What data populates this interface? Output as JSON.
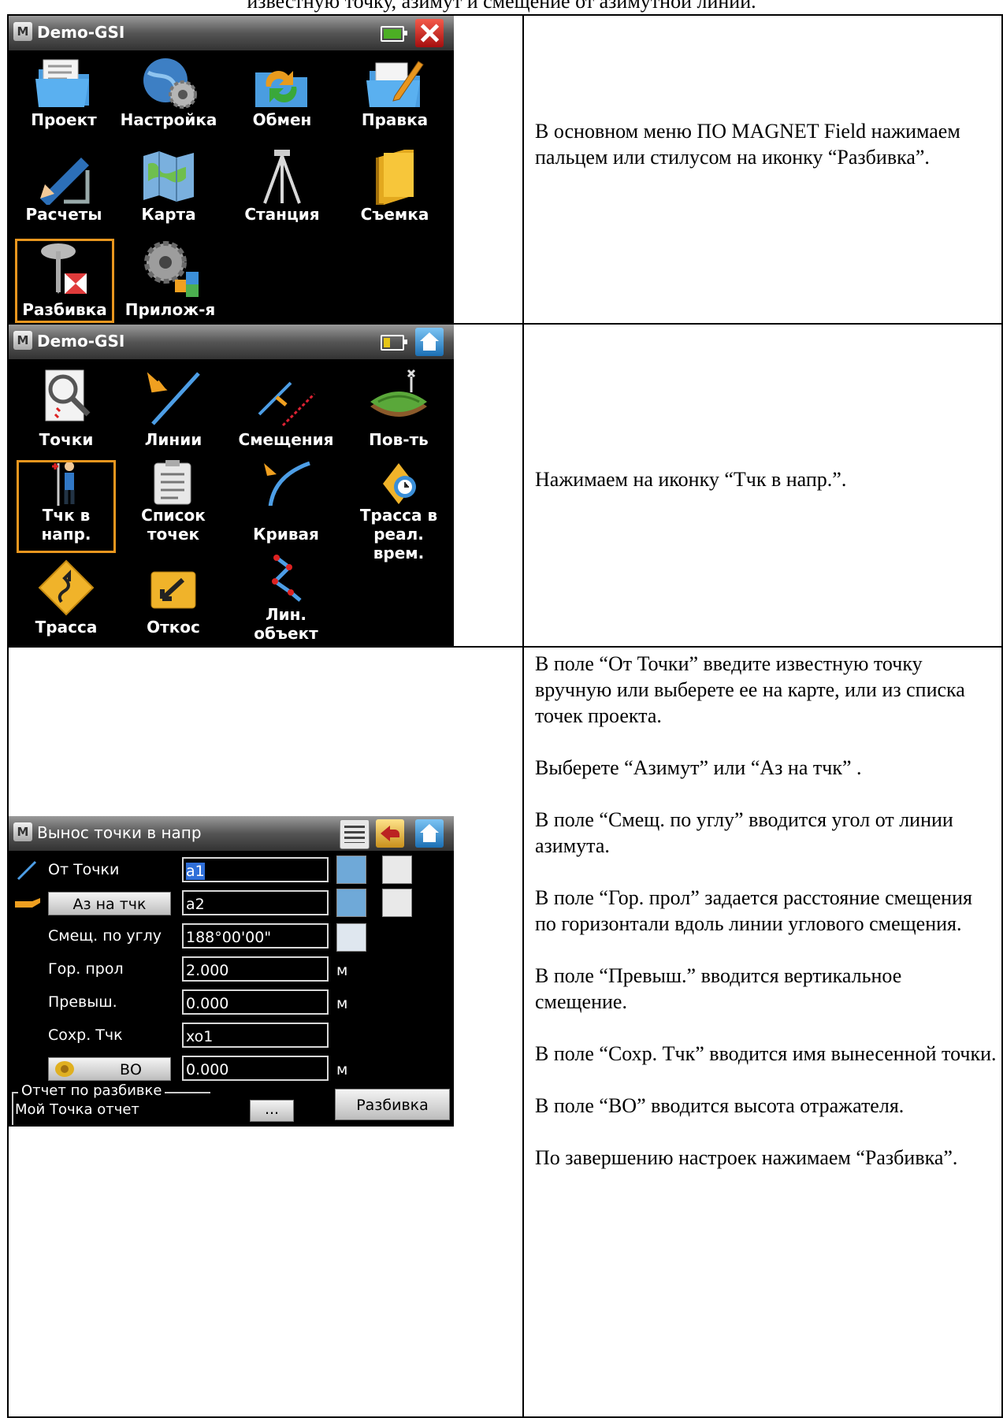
{
  "top_caption": "известную точку, азимут и смещение от азимутной линии.",
  "screen1": {
    "title": "Demo-GSI",
    "tiles": [
      {
        "label": "Проект",
        "icon": "folder-icon"
      },
      {
        "label": "Настройка",
        "icon": "globe-gear-icon"
      },
      {
        "label": "Обмен",
        "icon": "exchange-folder-icon"
      },
      {
        "label": "Правка",
        "icon": "edit-folder-icon"
      },
      {
        "label": "Расчеты",
        "icon": "ruler-pencil-icon"
      },
      {
        "label": "Карта",
        "icon": "map-icon"
      },
      {
        "label": "Станция",
        "icon": "tripod-icon"
      },
      {
        "label": "Съемка",
        "icon": "notebook-icon"
      },
      {
        "label": "Разбивка",
        "icon": "stakeout-pin-icon",
        "selected": true
      },
      {
        "label": "Прилож-я",
        "icon": "gear-blocks-icon"
      }
    ]
  },
  "screen2": {
    "title": "Demo-GSI",
    "tiles": [
      {
        "label": "Точки",
        "icon": "points-magnifier-icon"
      },
      {
        "label": "Линии",
        "icon": "line-icon"
      },
      {
        "label": "Смещения",
        "icon": "offset-line-icon"
      },
      {
        "label": "Пов-ть",
        "icon": "surface-icon"
      },
      {
        "label": "Тчк в напр.",
        "label_lines": [
          "Тчк в",
          "напр."
        ],
        "icon": "person-pole-icon",
        "selected": true
      },
      {
        "label": "Список точек",
        "label_lines": [
          "Список",
          "точек"
        ],
        "icon": "clipboard-list-icon"
      },
      {
        "label": "Кривая",
        "icon": "curve-icon"
      },
      {
        "label": "Трасса в реал. врем.",
        "label_lines": [
          "Трасса в",
          "реал.",
          "врем."
        ],
        "icon": "road-clock-icon"
      },
      {
        "label": "Трасса",
        "icon": "road-sign-icon"
      },
      {
        "label": "Откос",
        "icon": "slope-arrow-icon"
      },
      {
        "label": "Лин. объект",
        "label_lines": [
          "Лин.",
          "объект"
        ],
        "icon": "polyline-icon"
      }
    ]
  },
  "screen3": {
    "title": "Вынос точки в напр",
    "from_point_label": "От Точки",
    "from_point_value": "a1",
    "azimuth_button": "Аз на тчк",
    "azimuth_value": "a2",
    "angle_offset_label": "Смещ. по углу",
    "angle_offset_value": "188°00'00\"",
    "hd_label": "Гор. прол",
    "hd_value": "2.000",
    "hd_unit": "м",
    "vd_label": "Превыш.",
    "vd_value": "0.000",
    "vd_unit": "м",
    "save_label": "Сохр. Тчк",
    "save_value": "xo1",
    "rh_button": "ВО",
    "rh_value": "0.000",
    "rh_unit": "м",
    "report_group": "Отчет по разбивке",
    "report_value": "Мой Точка отчет",
    "report_more": "...",
    "stakeout_button": "Разбивка"
  },
  "descriptions": {
    "row1": "В основном меню ПО MAGNET Field нажимаем пальцем или стилусом на иконку “Разбивка”.",
    "row2": "Нажимаем на иконку “Тчк в напр.”.",
    "row3": [
      "В поле “От Точки” введите известную точку вручную или выберете ее на карте, или из списка точек проекта.",
      "Выберете “Азимут” или “Аз на тчк” .",
      "В поле “Смещ. по углу” вводится угол от линии азимута.",
      "В поле “Гор. прол” задается расстояние смещения по горизонтали вдоль линии углового смещения.",
      "В поле “Превыш.” вводится вертикальное смещение.",
      "В поле “Сохр. Тчк” вводится имя вынесенной точки.",
      "В поле “ВО” вводится высота отражателя.",
      "По завершению настроек нажимаем “Разбивка”."
    ]
  }
}
